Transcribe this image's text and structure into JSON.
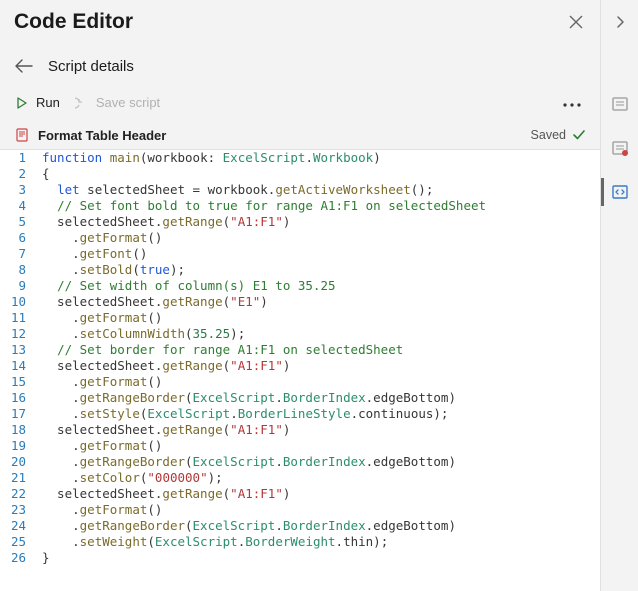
{
  "header": {
    "title": "Code Editor",
    "subtitle": "Script details"
  },
  "toolbar": {
    "run_label": "Run",
    "save_label": "Save script",
    "more_label": "..."
  },
  "script": {
    "name": "Format Table Header",
    "status": "Saved"
  },
  "code_tokens": [
    [
      [
        "k",
        "function"
      ],
      [
        "plain",
        " "
      ],
      [
        "fn",
        "main"
      ],
      [
        "plain",
        "(workbook"
      ],
      [
        "plain",
        ": "
      ],
      [
        "type",
        "ExcelScript"
      ],
      [
        "plain",
        "."
      ],
      [
        "type",
        "Workbook"
      ],
      [
        "plain",
        ")"
      ]
    ],
    [
      [
        "plain",
        "{"
      ]
    ],
    [
      [
        "plain",
        "  "
      ],
      [
        "k",
        "let"
      ],
      [
        "plain",
        " selectedSheet = workbook."
      ],
      [
        "fn",
        "getActiveWorksheet"
      ],
      [
        "plain",
        "();"
      ]
    ],
    [
      [
        "plain",
        "  "
      ],
      [
        "cmt",
        "// Set font bold to true for range A1:F1 on selectedSheet"
      ]
    ],
    [
      [
        "plain",
        "  selectedSheet."
      ],
      [
        "fn",
        "getRange"
      ],
      [
        "plain",
        "("
      ],
      [
        "str",
        "\"A1:F1\""
      ],
      [
        "plain",
        ")"
      ]
    ],
    [
      [
        "plain",
        "    ."
      ],
      [
        "fn",
        "getFormat"
      ],
      [
        "plain",
        "()"
      ]
    ],
    [
      [
        "plain",
        "    ."
      ],
      [
        "fn",
        "getFont"
      ],
      [
        "plain",
        "()"
      ]
    ],
    [
      [
        "plain",
        "    ."
      ],
      [
        "fn",
        "setBold"
      ],
      [
        "plain",
        "("
      ],
      [
        "bool",
        "true"
      ],
      [
        "plain",
        ");"
      ]
    ],
    [
      [
        "plain",
        "  "
      ],
      [
        "cmt",
        "// Set width of column(s) E1 to 35.25"
      ]
    ],
    [
      [
        "plain",
        "  selectedSheet."
      ],
      [
        "fn",
        "getRange"
      ],
      [
        "plain",
        "("
      ],
      [
        "str",
        "\"E1\""
      ],
      [
        "plain",
        ")"
      ]
    ],
    [
      [
        "plain",
        "    ."
      ],
      [
        "fn",
        "getFormat"
      ],
      [
        "plain",
        "()"
      ]
    ],
    [
      [
        "plain",
        "    ."
      ],
      [
        "fn",
        "setColumnWidth"
      ],
      [
        "plain",
        "("
      ],
      [
        "num",
        "35.25"
      ],
      [
        "plain",
        ");"
      ]
    ],
    [
      [
        "plain",
        "  "
      ],
      [
        "cmt",
        "// Set border for range A1:F1 on selectedSheet"
      ]
    ],
    [
      [
        "plain",
        "  selectedSheet."
      ],
      [
        "fn",
        "getRange"
      ],
      [
        "plain",
        "("
      ],
      [
        "str",
        "\"A1:F1\""
      ],
      [
        "plain",
        ")"
      ]
    ],
    [
      [
        "plain",
        "    ."
      ],
      [
        "fn",
        "getFormat"
      ],
      [
        "plain",
        "()"
      ]
    ],
    [
      [
        "plain",
        "    ."
      ],
      [
        "fn",
        "getRangeBorder"
      ],
      [
        "plain",
        "("
      ],
      [
        "type",
        "ExcelScript"
      ],
      [
        "plain",
        "."
      ],
      [
        "type",
        "BorderIndex"
      ],
      [
        "plain",
        ".edgeBottom)"
      ]
    ],
    [
      [
        "plain",
        "    ."
      ],
      [
        "fn",
        "setStyle"
      ],
      [
        "plain",
        "("
      ],
      [
        "type",
        "ExcelScript"
      ],
      [
        "plain",
        "."
      ],
      [
        "type",
        "BorderLineStyle"
      ],
      [
        "plain",
        ".continuous);"
      ]
    ],
    [
      [
        "plain",
        "  selectedSheet."
      ],
      [
        "fn",
        "getRange"
      ],
      [
        "plain",
        "("
      ],
      [
        "str",
        "\"A1:F1\""
      ],
      [
        "plain",
        ")"
      ]
    ],
    [
      [
        "plain",
        "    ."
      ],
      [
        "fn",
        "getFormat"
      ],
      [
        "plain",
        "()"
      ]
    ],
    [
      [
        "plain",
        "    ."
      ],
      [
        "fn",
        "getRangeBorder"
      ],
      [
        "plain",
        "("
      ],
      [
        "type",
        "ExcelScript"
      ],
      [
        "plain",
        "."
      ],
      [
        "type",
        "BorderIndex"
      ],
      [
        "plain",
        ".edgeBottom)"
      ]
    ],
    [
      [
        "plain",
        "    ."
      ],
      [
        "fn",
        "setColor"
      ],
      [
        "plain",
        "("
      ],
      [
        "str",
        "\"000000\""
      ],
      [
        "plain",
        ");"
      ]
    ],
    [
      [
        "plain",
        "  selectedSheet."
      ],
      [
        "fn",
        "getRange"
      ],
      [
        "plain",
        "("
      ],
      [
        "str",
        "\"A1:F1\""
      ],
      [
        "plain",
        ")"
      ]
    ],
    [
      [
        "plain",
        "    ."
      ],
      [
        "fn",
        "getFormat"
      ],
      [
        "plain",
        "()"
      ]
    ],
    [
      [
        "plain",
        "    ."
      ],
      [
        "fn",
        "getRangeBorder"
      ],
      [
        "plain",
        "("
      ],
      [
        "type",
        "ExcelScript"
      ],
      [
        "plain",
        "."
      ],
      [
        "type",
        "BorderIndex"
      ],
      [
        "plain",
        ".edgeBottom)"
      ]
    ],
    [
      [
        "plain",
        "    ."
      ],
      [
        "fn",
        "setWeight"
      ],
      [
        "plain",
        "("
      ],
      [
        "type",
        "ExcelScript"
      ],
      [
        "plain",
        "."
      ],
      [
        "type",
        "BorderWeight"
      ],
      [
        "plain",
        ".thin);"
      ]
    ],
    [
      [
        "plain",
        "}"
      ]
    ]
  ]
}
